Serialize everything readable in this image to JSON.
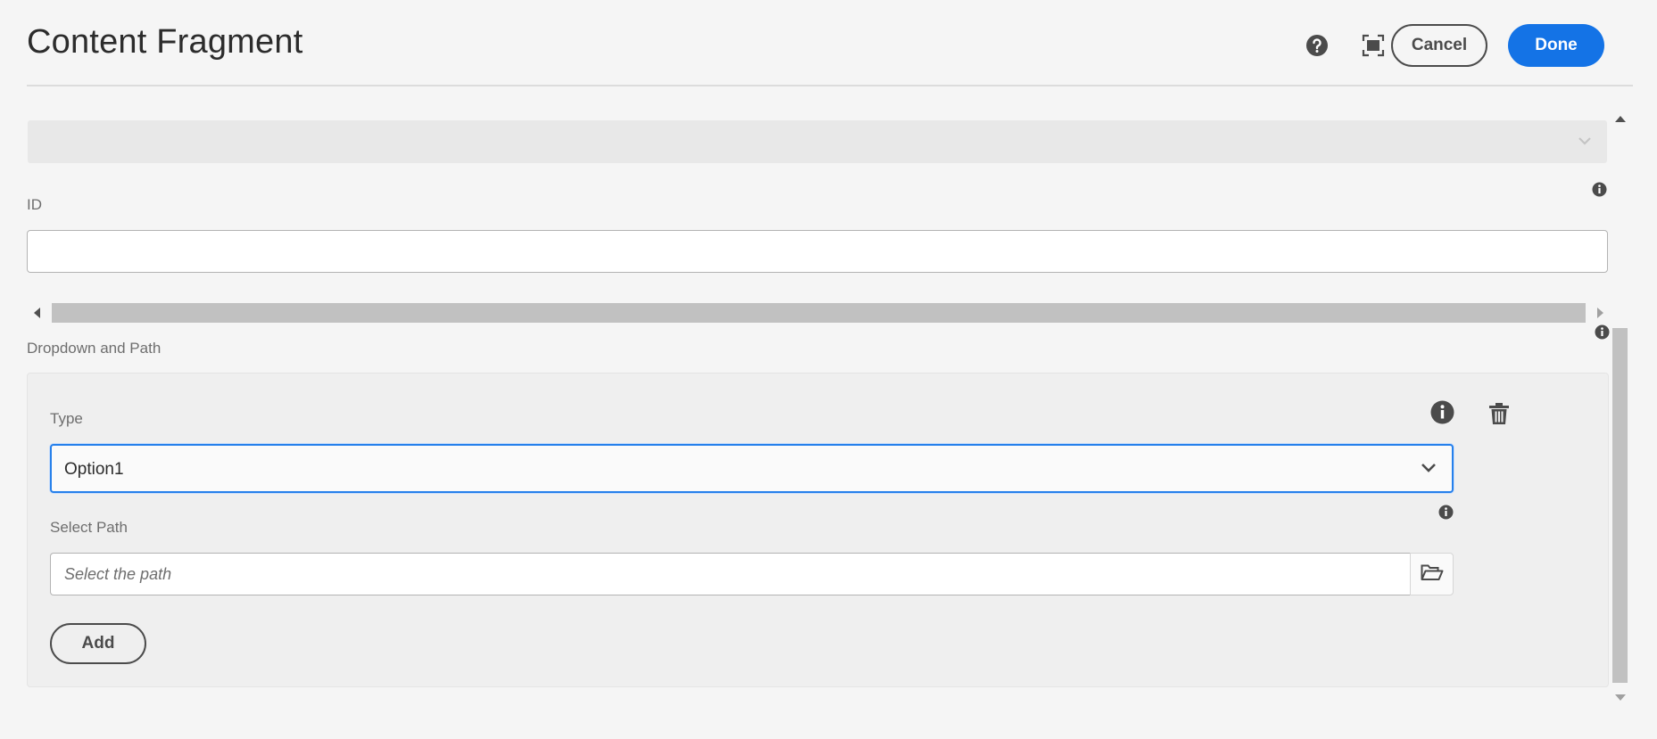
{
  "header": {
    "title": "Content Fragment",
    "help_icon": "help-icon",
    "fullscreen_icon": "fullscreen-icon",
    "cancel_label": "Cancel",
    "done_label": "Done"
  },
  "form": {
    "collapsed_select_value": "",
    "id_field": {
      "label": "ID",
      "value": ""
    },
    "dropdown_path": {
      "label": "Dropdown and Path",
      "items": [
        {
          "type_label": "Type",
          "type_value": "Option1",
          "path_label": "Select Path",
          "path_placeholder": "Select the path",
          "path_value": ""
        }
      ],
      "add_label": "Add"
    }
  },
  "colors": {
    "accent": "#1473e6",
    "focus_border": "#2680eb",
    "background": "#f5f5f5"
  }
}
